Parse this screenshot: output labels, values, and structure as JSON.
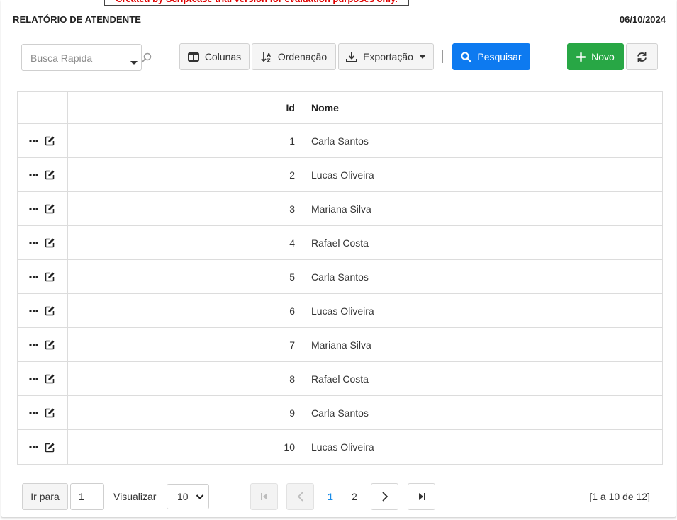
{
  "banner": {
    "text": "Created by Scriptcase trial version for evaluation purposes only."
  },
  "header": {
    "title": "RELATÓRIO DE ATENDENTE",
    "date": "06/10/2024"
  },
  "toolbar": {
    "search_placeholder": "Busca Rapida",
    "colunas_label": "Colunas",
    "ordenacao_label": "Ordenação",
    "exportacao_label": "Exportação",
    "pesquisar_label": "Pesquisar",
    "novo_label": "Novo"
  },
  "table": {
    "columns": [
      "",
      "Id",
      "Nome"
    ],
    "rows": [
      {
        "id": "1",
        "nome": "Carla Santos"
      },
      {
        "id": "2",
        "nome": "Lucas Oliveira"
      },
      {
        "id": "3",
        "nome": "Mariana Silva"
      },
      {
        "id": "4",
        "nome": "Rafael Costa"
      },
      {
        "id": "5",
        "nome": "Carla Santos"
      },
      {
        "id": "6",
        "nome": "Lucas Oliveira"
      },
      {
        "id": "7",
        "nome": "Mariana Silva"
      },
      {
        "id": "8",
        "nome": "Rafael Costa"
      },
      {
        "id": "9",
        "nome": "Carla Santos"
      },
      {
        "id": "10",
        "nome": "Lucas Oliveira"
      }
    ]
  },
  "pagination": {
    "goto_label": "Ir para",
    "goto_value": "1",
    "view_label": "Visualizar",
    "page_size": "10",
    "pages": [
      "1",
      "2"
    ],
    "current_page": "1",
    "summary": "[1 a 10 de 12]"
  },
  "colors": {
    "primary": "#0d7af0",
    "success": "#28a745",
    "active_page": "#1a8ce8",
    "banner_text": "#e00000"
  }
}
